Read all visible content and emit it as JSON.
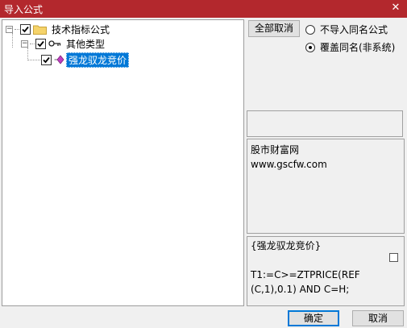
{
  "window": {
    "title": "导入公式",
    "close_glyph": "✕"
  },
  "tree": {
    "root_label": "技术指标公式",
    "category_label": "其他类型",
    "item_label": "强龙驭龙竞价",
    "expander_minus": "−"
  },
  "toolbar": {
    "cancel_all_label": "全部取消"
  },
  "options": {
    "no_import_same_name": "不导入同名公式",
    "overwrite_same_name": "覆盖同名(非系统)",
    "selected": "overwrite_same_name"
  },
  "info": {
    "line1": "股市财富网",
    "line2": "www.gscfw.com"
  },
  "code": {
    "line1": "{强龙驭龙竞价}",
    "line2": "",
    "line3": "T1:=C>=ZTPRICE(REF",
    "line4": "(C,1),0.1) AND C=H;"
  },
  "buttons": {
    "ok_label": "确定",
    "cancel_label": "取消"
  },
  "colors": {
    "titlebar": "#b3282d",
    "selection": "#0078d7"
  }
}
